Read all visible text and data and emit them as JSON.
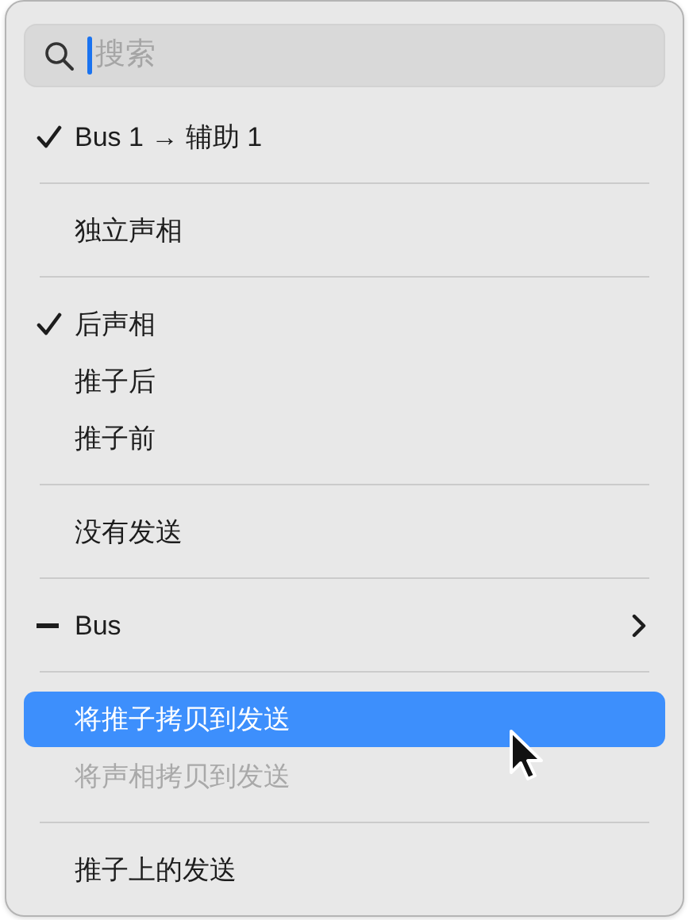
{
  "search": {
    "placeholder": "搜索",
    "focused": true
  },
  "items": [
    {
      "kind": "item",
      "label": "Bus 1 → 辅助 1",
      "checked": true,
      "mixed": false,
      "selected": false,
      "disabled": false,
      "submenu": false
    },
    {
      "kind": "separator"
    },
    {
      "kind": "item",
      "label": "独立声相",
      "checked": false,
      "mixed": false,
      "selected": false,
      "disabled": false,
      "submenu": false
    },
    {
      "kind": "separator"
    },
    {
      "kind": "item",
      "label": "后声相",
      "checked": true,
      "mixed": false,
      "selected": false,
      "disabled": false,
      "submenu": false
    },
    {
      "kind": "item",
      "label": "推子后",
      "checked": false,
      "mixed": false,
      "selected": false,
      "disabled": false,
      "submenu": false
    },
    {
      "kind": "item",
      "label": "推子前",
      "checked": false,
      "mixed": false,
      "selected": false,
      "disabled": false,
      "submenu": false
    },
    {
      "kind": "separator"
    },
    {
      "kind": "item",
      "label": "没有发送",
      "checked": false,
      "mixed": false,
      "selected": false,
      "disabled": false,
      "submenu": false
    },
    {
      "kind": "separator"
    },
    {
      "kind": "item",
      "label": "Bus",
      "checked": false,
      "mixed": true,
      "selected": false,
      "disabled": false,
      "submenu": true
    },
    {
      "kind": "separator"
    },
    {
      "kind": "item",
      "label": "将推子拷贝到发送",
      "checked": false,
      "mixed": false,
      "selected": true,
      "disabled": false,
      "submenu": false
    },
    {
      "kind": "item",
      "label": "将声相拷贝到发送",
      "checked": false,
      "mixed": false,
      "selected": false,
      "disabled": true,
      "submenu": false
    },
    {
      "kind": "separator"
    },
    {
      "kind": "item",
      "label": "推子上的发送",
      "checked": false,
      "mixed": false,
      "selected": false,
      "disabled": false,
      "submenu": false
    }
  ],
  "pointer": {
    "visible": true
  }
}
